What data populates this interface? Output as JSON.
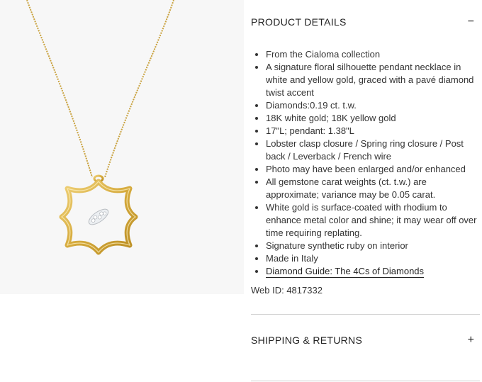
{
  "product_details": {
    "title": "PRODUCT DETAILS",
    "toggle": "−",
    "bullets": [
      "From the Cialoma collection",
      "A signature floral silhouette pendant necklace in white and yellow gold, graced with a pavé diamond twist accent",
      "Diamonds:0.19 ct. t.w.",
      "18K white gold; 18K yellow gold",
      "17\"L; pendant: 1.38\"L",
      "Lobster clasp closure / Spring ring closure / Post back / Leverback / French wire",
      "Photo may have been enlarged and/or enhanced",
      "All gemstone carat weights (ct. t.w.) are approximate; variance may be 0.05 carat.",
      "White gold is surface-coated with rhodium to enhance metal color and shine; it may wear off over time requiring replating.",
      "Signature synthetic ruby on interior",
      "Made in Italy"
    ],
    "guide_link": "Diamond Guide: The 4Cs of Diamonds",
    "web_id": "Web ID: 4817332"
  },
  "shipping": {
    "title": "SHIPPING & RETURNS",
    "toggle": "+"
  },
  "colors": {
    "gold": "#d9b24a",
    "panel_bg": "#f7f7f7",
    "divider": "#cfcfcf"
  }
}
